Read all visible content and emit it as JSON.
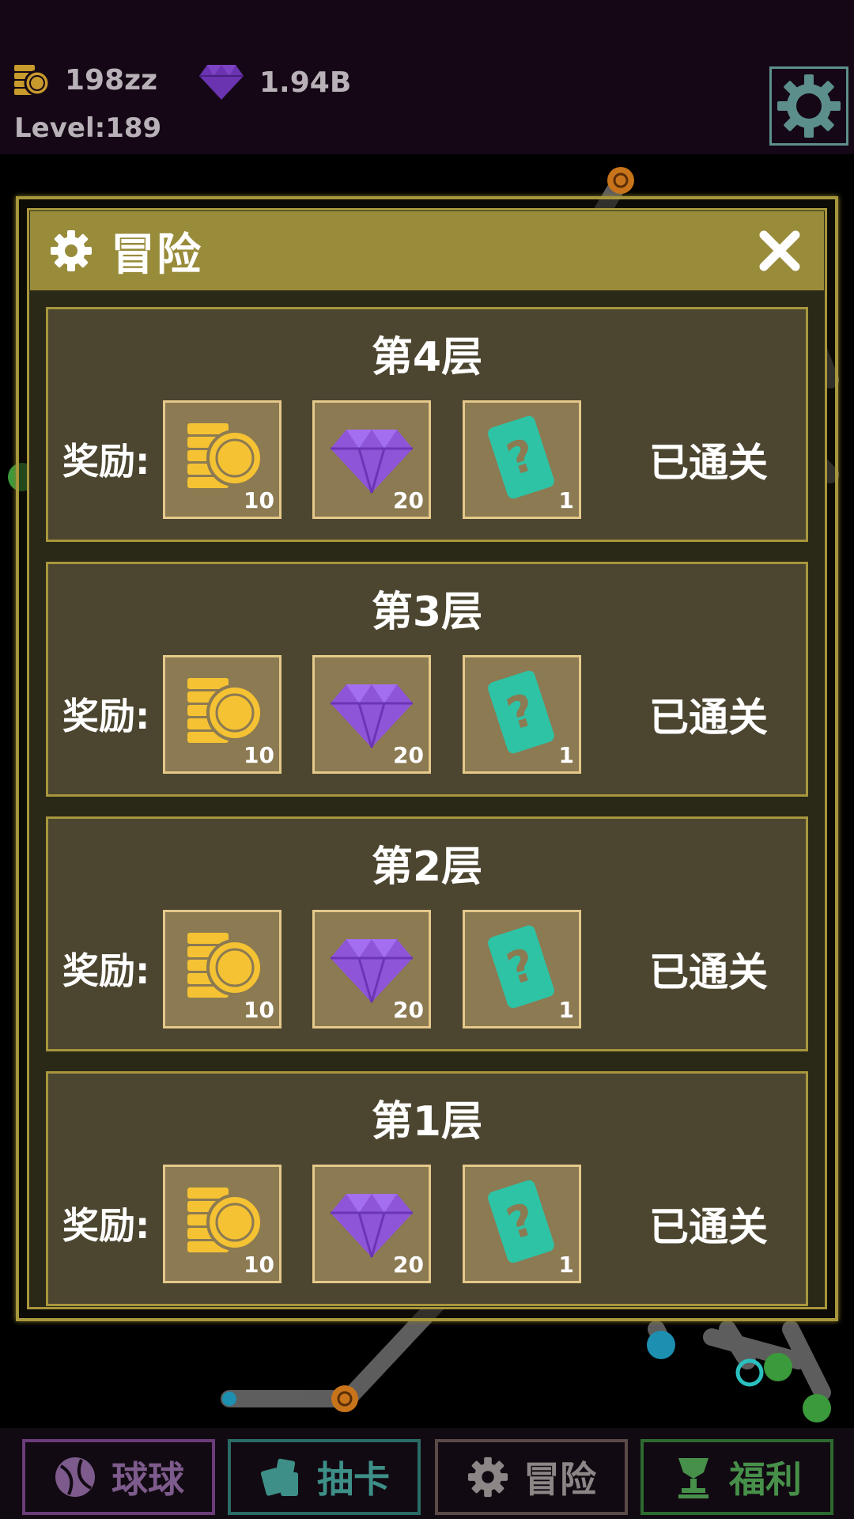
{
  "topbar": {
    "coins": "198zz",
    "gems": "1.94B",
    "level": "Level:189"
  },
  "modal": {
    "title": "冒险",
    "floors": [
      {
        "title": "第4层",
        "reward_label": "奖励:",
        "coins": "10",
        "gems": "20",
        "cards": "1",
        "status": "已通关"
      },
      {
        "title": "第3层",
        "reward_label": "奖励:",
        "coins": "10",
        "gems": "20",
        "cards": "1",
        "status": "已通关"
      },
      {
        "title": "第2层",
        "reward_label": "奖励:",
        "coins": "10",
        "gems": "20",
        "cards": "1",
        "status": "已通关"
      },
      {
        "title": "第1层",
        "reward_label": "奖励:",
        "coins": "10",
        "gems": "20",
        "cards": "1",
        "status": "已通关"
      }
    ]
  },
  "nav": {
    "balls": "球球",
    "draw": "抽卡",
    "adventure": "冒险",
    "welfare": "福利"
  },
  "colors": {
    "gold": "#f5c233",
    "gem": "#8e55d9",
    "card": "#2ec3a5",
    "panel": "#4c4630",
    "border": "#a7963c"
  }
}
